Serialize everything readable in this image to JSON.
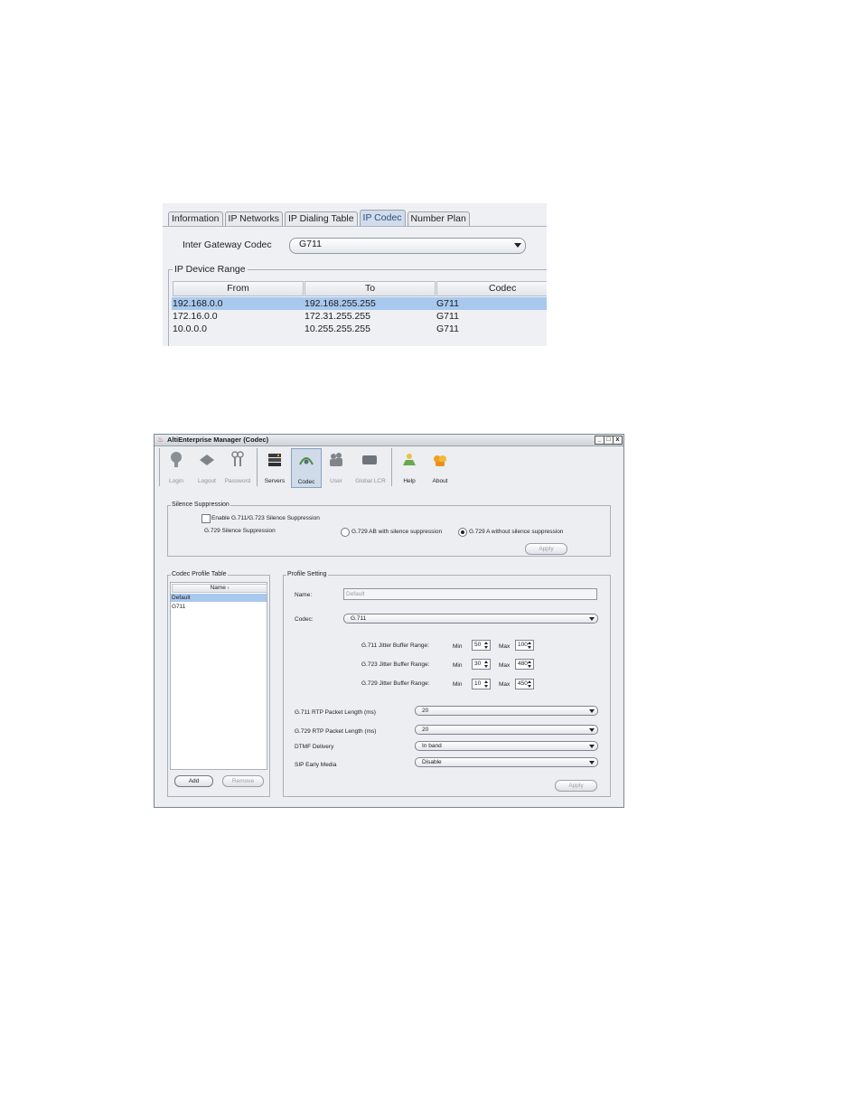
{
  "panel1": {
    "tabs": [
      {
        "label": "Information"
      },
      {
        "label": "IP Networks"
      },
      {
        "label": "IP Dialing Table"
      },
      {
        "label": "IP Codec",
        "active": true
      },
      {
        "label": "Number Plan"
      }
    ],
    "inter_gateway_label": "Inter Gateway Codec",
    "inter_gateway_value": "G711",
    "device_range_title": "IP Device Range",
    "columns": [
      "From",
      "To",
      "Codec"
    ],
    "rows": [
      {
        "from": "192.168.0.0",
        "to": "192.168.255.255",
        "codec": "G711",
        "selected": true
      },
      {
        "from": "172.16.0.0",
        "to": "172.31.255.255",
        "codec": "G711"
      },
      {
        "from": "10.0.0.0",
        "to": "10.255.255.255",
        "codec": "G711"
      }
    ],
    "selection_color": "#a8c8ee"
  },
  "window": {
    "title": "AltiEnterprise Manager  (Codec)",
    "controls": {
      "minimize": "_",
      "maximize": "□",
      "close": "x"
    },
    "toolbar": [
      {
        "label": "Login",
        "icon": "login-icon",
        "enabled": false
      },
      {
        "label": "Logout",
        "icon": "logout-icon",
        "enabled": false
      },
      {
        "label": "Password",
        "icon": "keys-icon",
        "enabled": false
      },
      {
        "label": "Servers",
        "icon": "servers-icon",
        "enabled": true
      },
      {
        "label": "Codec",
        "icon": "codec-icon",
        "enabled": true,
        "active": true
      },
      {
        "label": "User",
        "icon": "users-icon",
        "enabled": false
      },
      {
        "label": "Global LCR",
        "icon": "global-lcr-icon",
        "enabled": false
      },
      {
        "label": "Help",
        "icon": "help-icon",
        "enabled": true
      },
      {
        "label": "About",
        "icon": "about-icon",
        "enabled": true
      }
    ],
    "silence": {
      "title": "Silence Suppression",
      "enable_label": "Enable G.711/G.723 Silence Suppression",
      "g729_label": "G.729 Silence Suppression",
      "option_ab": "G.729 AB with silence suppression",
      "option_a": "G.729 A without silence suppression",
      "apply": "Apply"
    },
    "profile_table": {
      "title": "Codec Profile Table",
      "column": "Name",
      "items": [
        {
          "name": "Default",
          "selected": true
        },
        {
          "name": "G711"
        }
      ],
      "add": "Add",
      "remove": "Remove"
    },
    "profile_setting": {
      "title": "Profile Setting",
      "name_label": "Name:",
      "name_value": "Default",
      "codec_label": "Codec:",
      "codec_value": "G.711",
      "min_label": "Min",
      "max_label": "Max",
      "jitter": [
        {
          "label": "G.711 Jitter Buffer Range:",
          "min": "50",
          "max": "100"
        },
        {
          "label": "G.723 Jitter Buffer Range:",
          "min": "30",
          "max": "480"
        },
        {
          "label": "G.729 Jitter Buffer Range:",
          "min": "10",
          "max": "450"
        }
      ],
      "g711_rtp_label": "G.711 RTP Packet Length (ms)",
      "g711_rtp_value": "20",
      "g729_rtp_label": "G.729 RTP Packet Length (ms)",
      "g729_rtp_value": "20",
      "dtmf_label": "DTMF Delivery",
      "dtmf_value": "In band",
      "sip_label": "SIP Early Media",
      "sip_value": "Disable",
      "apply": "Apply"
    }
  }
}
